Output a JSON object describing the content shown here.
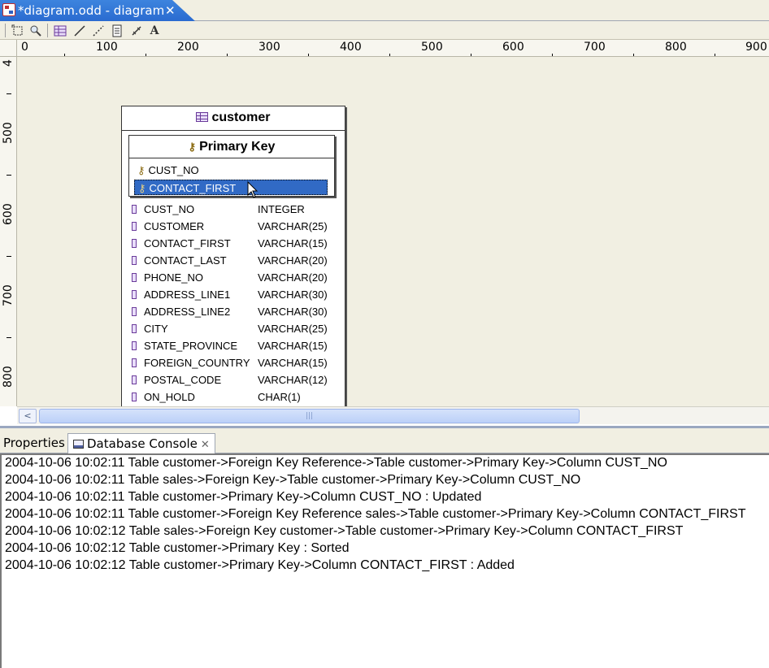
{
  "editor_tab": {
    "title": "*diagram.odd - diagram",
    "close": "✕"
  },
  "toolbar": {
    "icons": [
      "select-icon",
      "zoom-icon",
      "table-tool-icon",
      "line-tool-icon",
      "dotted-line-tool-icon",
      "note-tool-icon",
      "link-tool-icon",
      "text-tool-icon"
    ],
    "text_tool_glyph": "A"
  },
  "ruler": {
    "h_labels": [
      "0",
      "100",
      "200",
      "300",
      "400",
      "500",
      "600",
      "700",
      "800",
      "900"
    ],
    "v_labels": [
      "4",
      "500",
      "600",
      "700",
      "800"
    ]
  },
  "table": {
    "name": "customer",
    "primary_key": {
      "title": "Primary Key",
      "columns": [
        "CUST_NO",
        "CONTACT_FIRST"
      ],
      "selected": "CONTACT_FIRST"
    },
    "columns": [
      {
        "name": "CUST_NO",
        "type": "INTEGER"
      },
      {
        "name": "CUSTOMER",
        "type": "VARCHAR(25)"
      },
      {
        "name": "CONTACT_FIRST",
        "type": "VARCHAR(15)"
      },
      {
        "name": "CONTACT_LAST",
        "type": "VARCHAR(20)"
      },
      {
        "name": "PHONE_NO",
        "type": "VARCHAR(20)"
      },
      {
        "name": "ADDRESS_LINE1",
        "type": "VARCHAR(30)"
      },
      {
        "name": "ADDRESS_LINE2",
        "type": "VARCHAR(30)"
      },
      {
        "name": "CITY",
        "type": "VARCHAR(25)"
      },
      {
        "name": "STATE_PROVINCE",
        "type": "VARCHAR(15)"
      },
      {
        "name": "FOREIGN_COUNTRY",
        "type": "VARCHAR(15)"
      },
      {
        "name": "POSTAL_CODE",
        "type": "VARCHAR(12)"
      },
      {
        "name": "ON_HOLD",
        "type": "CHAR(1)"
      }
    ]
  },
  "scrollbar": {
    "left_arrow": "<",
    "grip": "|||"
  },
  "views": {
    "properties_label": "Properties",
    "console_label": "Database Console",
    "close": "✕"
  },
  "console": {
    "lines": [
      "2004-10-06 10:02:11 Table customer->Foreign Key Reference->Table customer->Primary Key->Column CUST_NO",
      "2004-10-06 10:02:11 Table sales->Foreign Key->Table customer->Primary Key->Column CUST_NO",
      "2004-10-06 10:02:11 Table customer->Primary Key->Column CUST_NO : Updated",
      "2004-10-06 10:02:11 Table customer->Foreign Key Reference sales->Table customer->Primary Key->Column CONTACT_FIRST",
      "2004-10-06 10:02:12 Table sales->Foreign Key customer->Table customer->Primary Key->Column CONTACT_FIRST",
      "2004-10-06 10:02:12 Table customer->Primary Key : Sorted",
      "2004-10-06 10:02:12 Table customer->Primary Key->Column CONTACT_FIRST : Added"
    ]
  }
}
